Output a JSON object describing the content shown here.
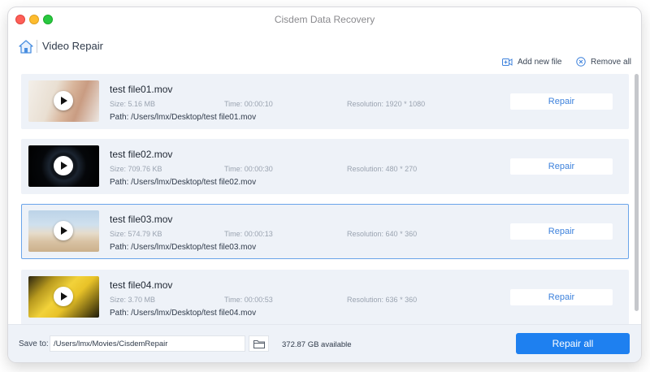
{
  "window": {
    "title": "Cisdem Data Recovery"
  },
  "header": {
    "title": "Video Repair"
  },
  "toolbar": {
    "add_label": "Add new file",
    "remove_label": "Remove all"
  },
  "labels": {
    "size": "Size:",
    "time": "Time:",
    "resolution": "Resolution:",
    "path": "Path:"
  },
  "files": [
    {
      "name": "test file01.mov",
      "size": "5.16 MB",
      "time": "00:00:10",
      "resolution": "1920 * 1080",
      "path": "/Users/lmx/Desktop/test file01.mov",
      "repair_label": "Repair"
    },
    {
      "name": "test file02.mov",
      "size": "709.76 KB",
      "time": "00:00:30",
      "resolution": "480 * 270",
      "path": "/Users/lmx/Desktop/test file02.mov",
      "repair_label": "Repair"
    },
    {
      "name": "test file03.mov",
      "size": "574.79 KB",
      "time": "00:00:13",
      "resolution": "640 * 360",
      "path": "/Users/lmx/Desktop/test file03.mov",
      "repair_label": "Repair"
    },
    {
      "name": "test file04.mov",
      "size": "3.70 MB",
      "time": "00:00:53",
      "resolution": "636 * 360",
      "path": "/Users/lmx/Desktop/test file04.mov",
      "repair_label": "Repair"
    }
  ],
  "footer": {
    "save_label": "Save to:",
    "save_path": "/Users/lmx/Movies/CisdemRepair",
    "available": "372.87 GB available",
    "repair_all_label": "Repair all"
  },
  "colors": {
    "accent": "#1e80f0",
    "selected_border": "#6aa4ea",
    "row_bg": "#eef2f8"
  }
}
